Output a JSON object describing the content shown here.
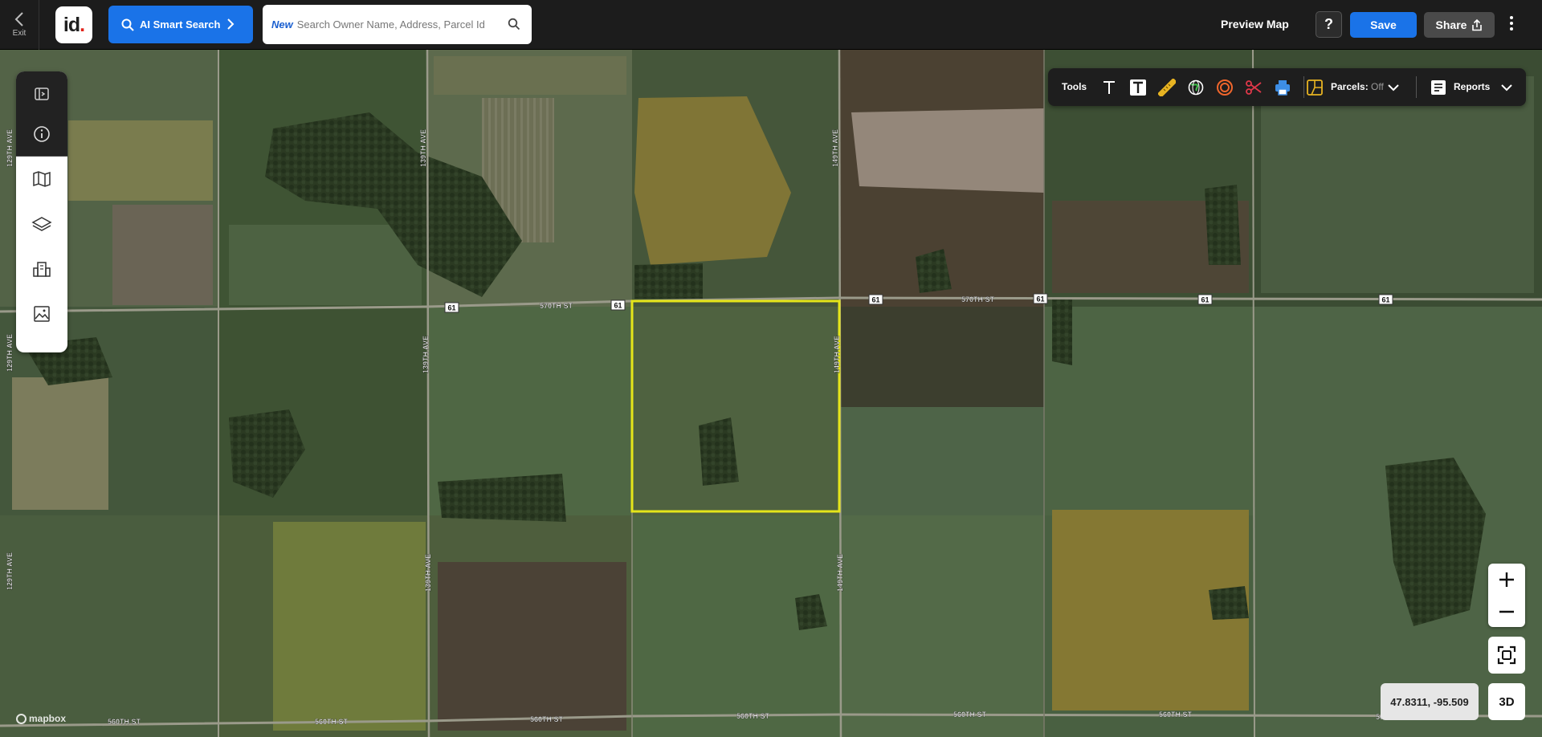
{
  "topbar": {
    "exit_label": "Exit",
    "logo_text": "id",
    "ai_search_label": "AI Smart Search",
    "search_new_tag": "New",
    "search_placeholder": "Search Owner Name, Address, Parcel Id",
    "preview_label": "Preview Map",
    "help_label": "?",
    "save_label": "Save",
    "share_label": "Share"
  },
  "toolbar": {
    "tools_label": "Tools",
    "parcels_label": "Parcels:",
    "parcels_state": "Off",
    "reports_label": "Reports"
  },
  "sidebar": {
    "items": [
      "collapse-panel",
      "info",
      "map",
      "layers",
      "buildings",
      "imagery"
    ]
  },
  "map": {
    "coordinates": "47.8311, -95.509",
    "btn_3d": "3D",
    "attribution": "mapbox",
    "road_labels": {
      "st570_a": "570TH ST",
      "st570_b": "570TH ST",
      "st560_a": "560TH ST",
      "st560_b": "560TH ST",
      "st560_c": "560TH ST",
      "st560_d": "560TH ST",
      "st560_e": "560TH ST",
      "st560_f": "560TH ST",
      "st560_g": "560TH ST",
      "ave129_a": "129TH AVE",
      "ave129_b": "129TH AVE",
      "ave129_c": "129TH AVE",
      "ave139_a": "139TH AVE",
      "ave139_b": "139TH AVE",
      "ave139_c": "139TH AVE",
      "ave149_a": "149TH AVE",
      "ave149_b": "149TH AVE",
      "ave149_c": "149TH AVE",
      "shield": "61"
    },
    "selection_color": "#e5e51a"
  }
}
